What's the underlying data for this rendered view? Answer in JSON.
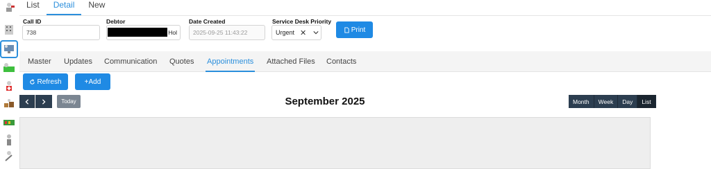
{
  "top_tabs": [
    "List",
    "Detail",
    "New"
  ],
  "form": {
    "call_id": {
      "label": "Call ID",
      "value": "738"
    },
    "debtor": {
      "label": "Debtor",
      "value_tail": "Hol"
    },
    "date_created": {
      "label": "Date Created",
      "value": "2025-09-25 11:43:22"
    },
    "priority": {
      "label": "Service Desk Priority",
      "value": "Urgent"
    },
    "print_label": "Print"
  },
  "detail_tabs": [
    "Master",
    "Updates",
    "Communication",
    "Quotes",
    "Appointments",
    "Attached Files",
    "Contacts"
  ],
  "actions": {
    "refresh_label": "Refresh",
    "add_label": "+Add"
  },
  "calendar": {
    "title": "September 2025",
    "today_label": "Today",
    "views": [
      "Month",
      "Week",
      "Day",
      "List"
    ],
    "active_view": "List"
  },
  "colors": {
    "accent": "#2c8fdc",
    "button": "#1f8ae4",
    "dark_button": "#2c3e50"
  }
}
